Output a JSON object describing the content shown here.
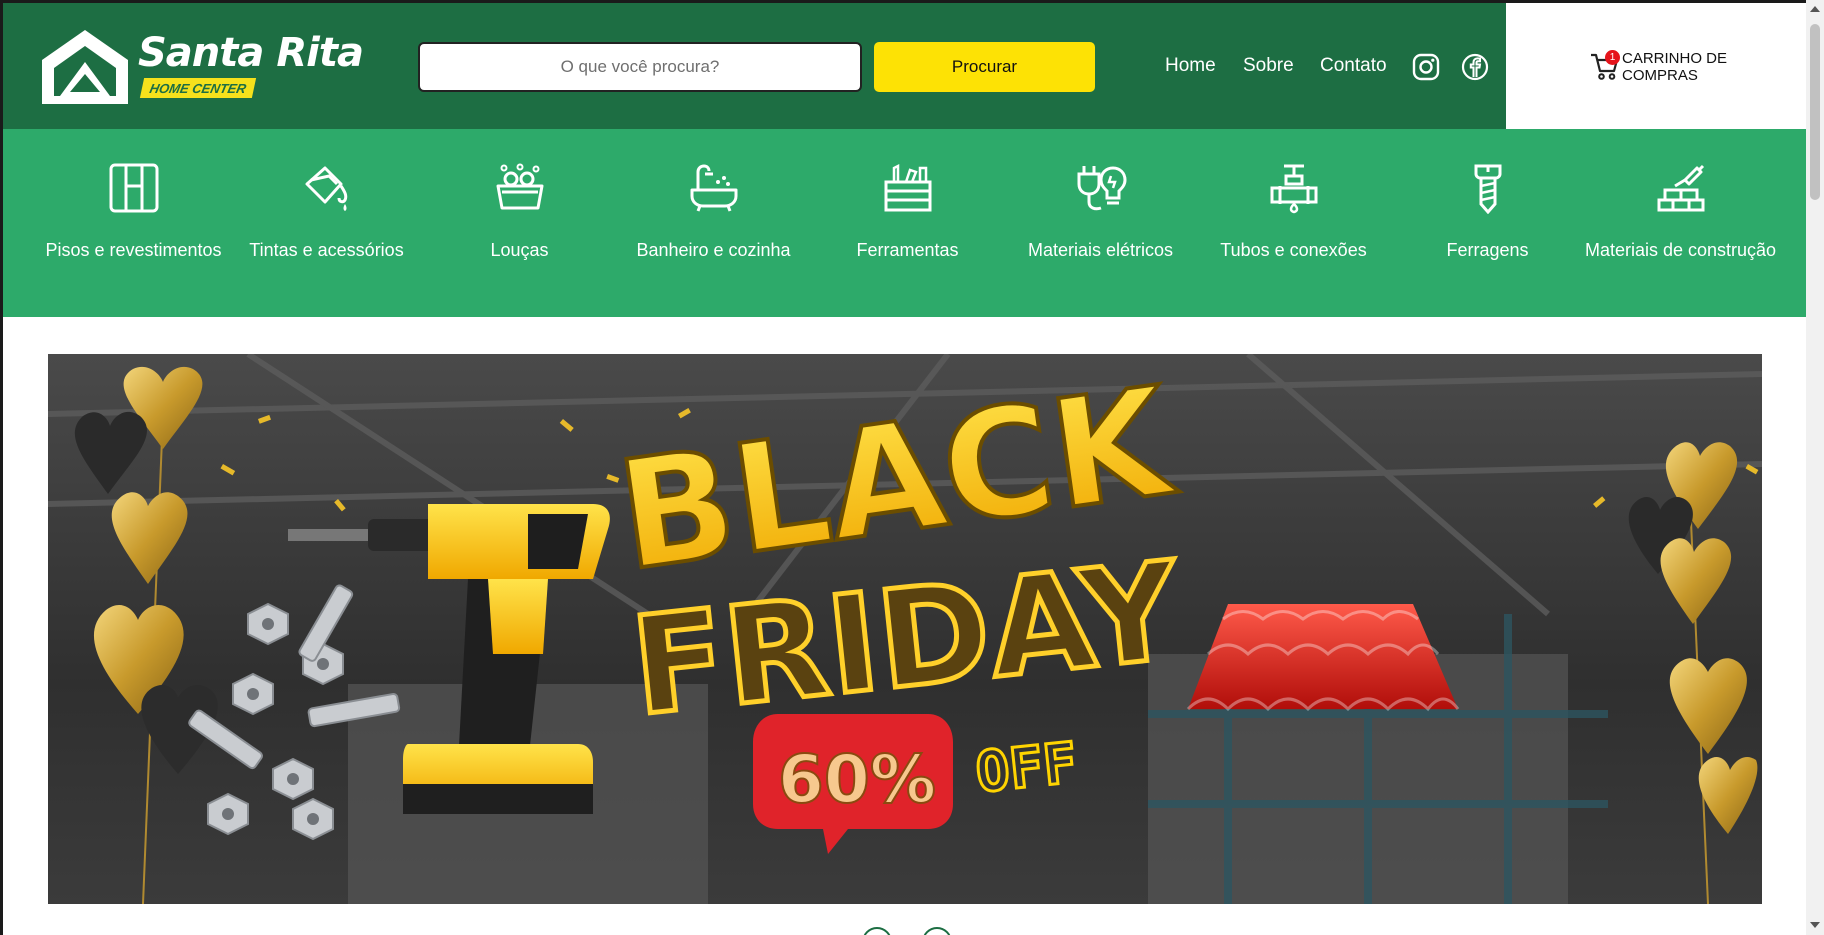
{
  "brand": {
    "name": "Santa Rita",
    "tagline": "HOME CENTER",
    "colors": {
      "primary": "#1d6e43",
      "secondary": "#2daa6a",
      "accent": "#fde205"
    }
  },
  "search": {
    "placeholder": "O que você procura?",
    "value": "",
    "button_label": "Procurar"
  },
  "nav": {
    "links": [
      {
        "label": "Home"
      },
      {
        "label": "Sobre"
      },
      {
        "label": "Contato"
      }
    ],
    "social": [
      {
        "icon": "instagram-icon"
      },
      {
        "icon": "facebook-icon"
      }
    ]
  },
  "cart": {
    "count": "1",
    "label": "CARRINHO DE COMPRAS",
    "icon": "cart-icon"
  },
  "categories": [
    {
      "label": "Pisos e revestimentos",
      "icon": "tiles-icon"
    },
    {
      "label": "Tintas e acessórios",
      "icon": "paint-bucket-icon"
    },
    {
      "label": "Louças",
      "icon": "dish-basin-icon"
    },
    {
      "label": "Banheiro e cozinha",
      "icon": "bathtub-icon"
    },
    {
      "label": "Ferramentas",
      "icon": "toolbox-icon"
    },
    {
      "label": "Materiais elétricos",
      "icon": "plug-bulb-icon"
    },
    {
      "label": "Tubos e conexões",
      "icon": "pipe-valve-icon"
    },
    {
      "label": "Ferragens",
      "icon": "screw-icon"
    },
    {
      "label": "Materiais de construção",
      "icon": "bricks-trowel-icon"
    }
  ],
  "banner": {
    "headline_1": "BLACK",
    "headline_2": "FRIDAY",
    "discount": "60%",
    "discount_suffix": "OFF"
  }
}
